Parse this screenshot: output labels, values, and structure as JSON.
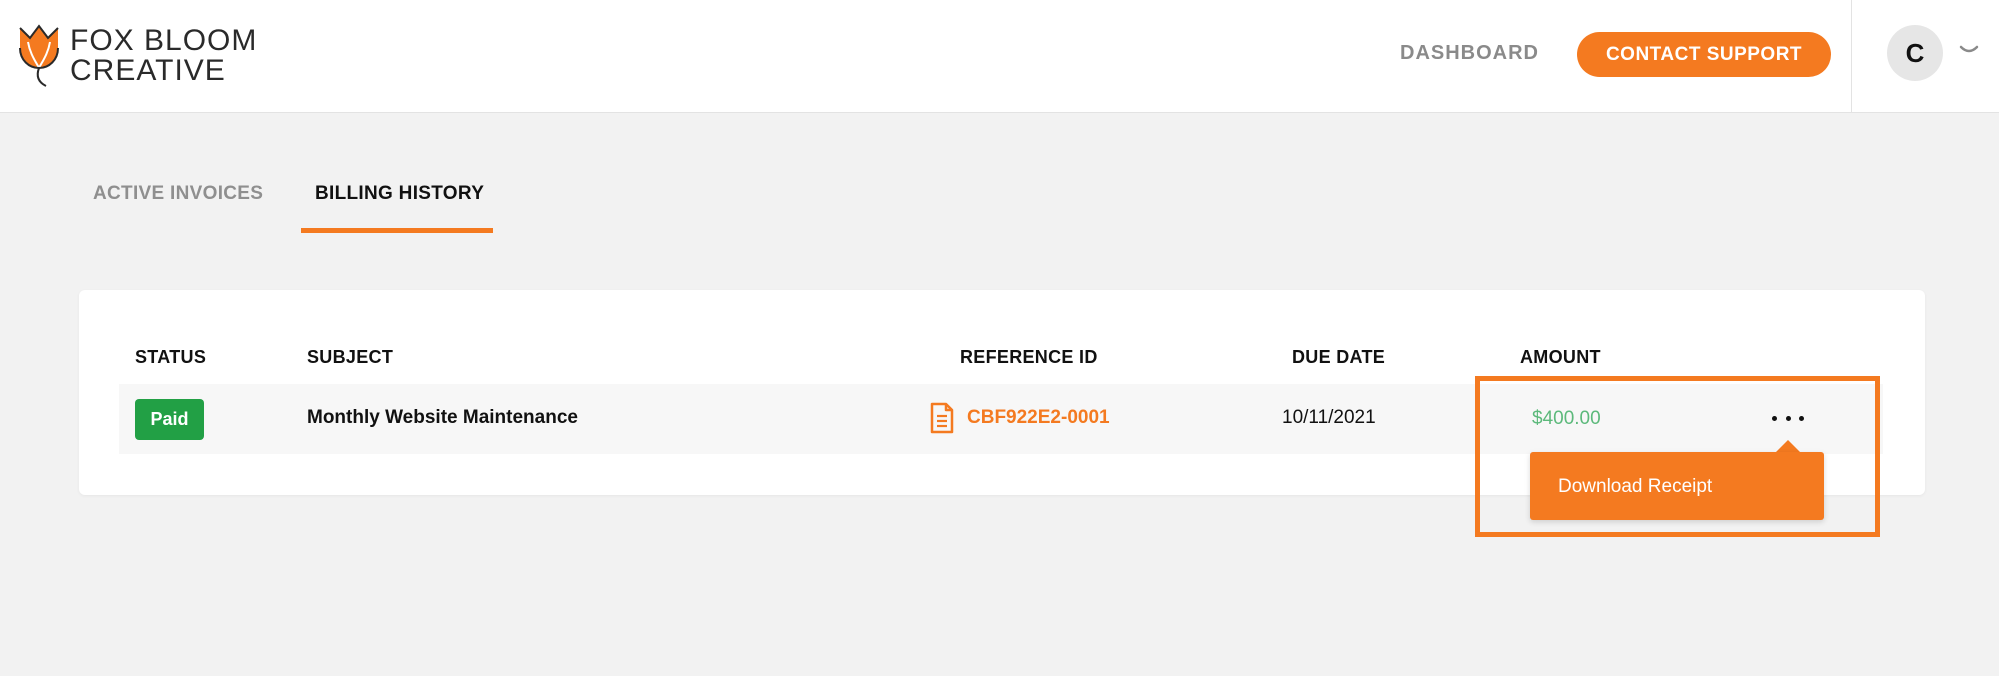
{
  "brand": {
    "name_line1": "FOX  BLOOM",
    "name_line2": "CREATIVE",
    "logo_icon": "fox-flower-logo",
    "accent_color": "#f47a20"
  },
  "header": {
    "dashboard_label": "DASHBOARD",
    "contact_label": "CONTACT SUPPORT",
    "avatar_initial": "C",
    "avatar_menu_icon": "chevron-down-icon"
  },
  "tabs": [
    {
      "label": "ACTIVE INVOICES",
      "active": false
    },
    {
      "label": "BILLING HISTORY",
      "active": true
    }
  ],
  "table": {
    "headers": {
      "status": "STATUS",
      "subject": "SUBJECT",
      "reference_id": "REFERENCE ID",
      "due_date": "DUE DATE",
      "amount": "AMOUNT"
    },
    "rows": [
      {
        "status": "Paid",
        "status_color": "#22a045",
        "subject": "Monthly Website Maintenance",
        "reference_icon": "document-icon",
        "reference_id": "CBF922E2-0001",
        "due_date": "10/11/2021",
        "amount": "$400.00",
        "amount_color": "#5cb97b",
        "actions_icon": "more-horizontal-icon"
      }
    ]
  },
  "row_menu": {
    "items": [
      {
        "label": "Download Receipt"
      }
    ]
  }
}
